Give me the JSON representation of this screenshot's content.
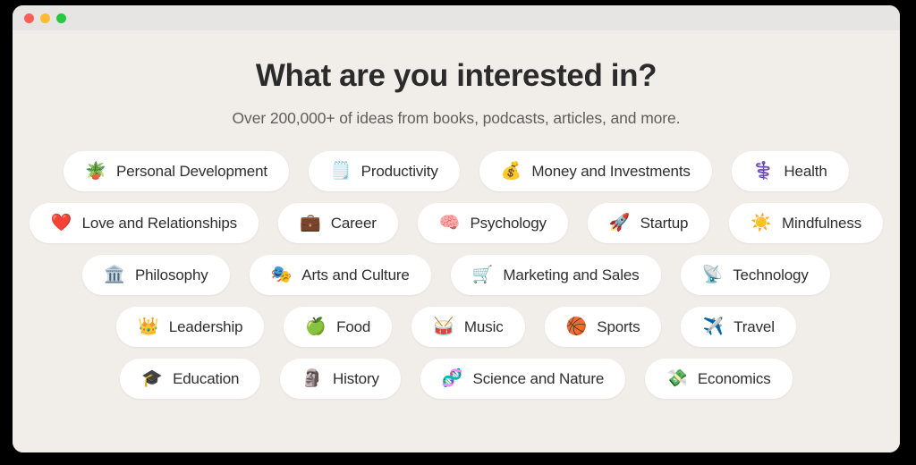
{
  "window": {
    "controls": [
      {
        "name": "close",
        "color": "#fa5f57"
      },
      {
        "name": "minimize",
        "color": "#febc2e"
      },
      {
        "name": "maximize",
        "color": "#28c840"
      }
    ]
  },
  "page": {
    "title": "What are you interested in?",
    "subtitle": "Over 200,000+ of ideas from books, podcasts, articles, and more."
  },
  "colors": {
    "background": "#f1eeea",
    "titlebar": "#e6e5e4",
    "chip_background": "#ffffff",
    "title_text": "#2b2b2b",
    "subtitle_text": "#5f5d5a",
    "chip_text": "#2e2e2e"
  },
  "interests": {
    "rows": [
      [
        {
          "label": "Personal Development",
          "emoji": "🪴",
          "icon": "potted-plant-icon"
        },
        {
          "label": "Productivity",
          "emoji": "🗒️",
          "icon": "notepad-icon"
        },
        {
          "label": "Money and Investments",
          "emoji": "💰",
          "icon": "money-bag-icon"
        },
        {
          "label": "Health",
          "emoji": "⚕️",
          "icon": "medical-symbol-icon"
        }
      ],
      [
        {
          "label": "Love and Relationships",
          "emoji": "❤️",
          "icon": "red-heart-icon"
        },
        {
          "label": "Career",
          "emoji": "💼",
          "icon": "briefcase-icon"
        },
        {
          "label": "Psychology",
          "emoji": "🧠",
          "icon": "brain-icon"
        },
        {
          "label": "Startup",
          "emoji": "🚀",
          "icon": "rocket-icon"
        },
        {
          "label": "Mindfulness",
          "emoji": "☀️",
          "icon": "sun-icon"
        }
      ],
      [
        {
          "label": "Philosophy",
          "emoji": "🏛️",
          "icon": "classical-building-icon"
        },
        {
          "label": "Arts and Culture",
          "emoji": "🎭",
          "icon": "performing-arts-masks-icon"
        },
        {
          "label": "Marketing and Sales",
          "emoji": "🛒",
          "icon": "shopping-cart-icon"
        },
        {
          "label": "Technology",
          "emoji": "📡",
          "icon": "satellite-antenna-icon"
        }
      ],
      [
        {
          "label": "Leadership",
          "emoji": "👑",
          "icon": "crown-icon"
        },
        {
          "label": "Food",
          "emoji": "🍏",
          "icon": "green-apple-icon"
        },
        {
          "label": "Music",
          "emoji": "🥁",
          "icon": "drum-icon"
        },
        {
          "label": "Sports",
          "emoji": "🏀",
          "icon": "basketball-icon"
        },
        {
          "label": "Travel",
          "emoji": "✈️",
          "icon": "airplane-icon"
        }
      ],
      [
        {
          "label": "Education",
          "emoji": "🎓",
          "icon": "graduation-cap-icon"
        },
        {
          "label": "History",
          "emoji": "🗿",
          "icon": "moai-icon"
        },
        {
          "label": "Science and Nature",
          "emoji": "🧬",
          "icon": "dna-icon"
        },
        {
          "label": "Economics",
          "emoji": "💸",
          "icon": "money-with-wings-icon"
        }
      ]
    ]
  }
}
